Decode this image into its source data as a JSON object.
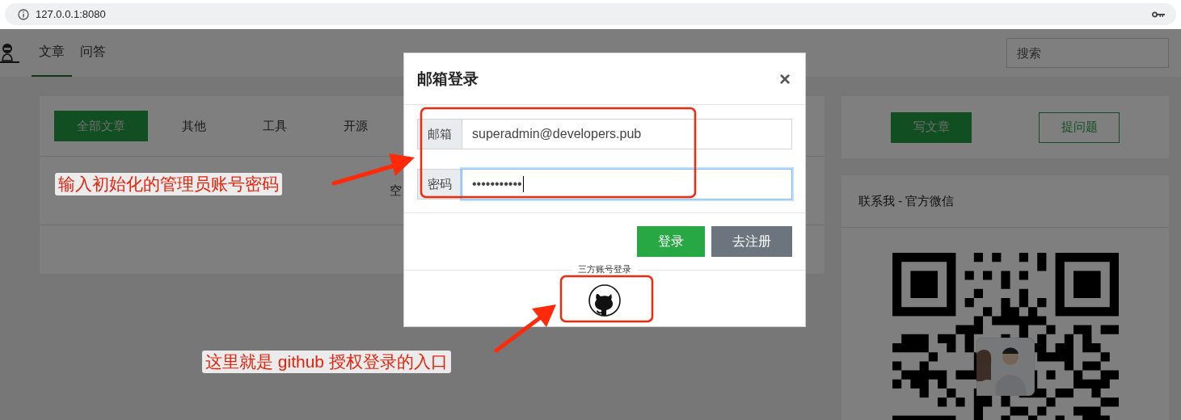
{
  "browser": {
    "address": "127.0.0.1:8080"
  },
  "header": {
    "nav": [
      {
        "label": "文章",
        "selected": true
      },
      {
        "label": "问答",
        "selected": false
      }
    ],
    "search": {
      "placeholder": "搜索"
    }
  },
  "categories": [
    {
      "label": "全部文章",
      "selected": true
    },
    {
      "label": "其他",
      "selected": false
    },
    {
      "label": "工具",
      "selected": false
    },
    {
      "label": "开源",
      "selected": false
    }
  ],
  "article_list": {
    "empty_text": "空"
  },
  "sidebar": {
    "actions": [
      {
        "label": "写文章",
        "kind": "primary"
      },
      {
        "label": "提问题",
        "kind": "outline"
      }
    ],
    "contact": {
      "title": "联系我 - 官方微信"
    }
  },
  "modal": {
    "title": "邮箱登录",
    "close": "×",
    "fields": [
      {
        "label": "邮箱",
        "value": "superadmin@developers.pub",
        "focused": false
      },
      {
        "label": "密码",
        "value": "•••••••••••",
        "focused": true
      }
    ],
    "buttons": [
      {
        "label": "登录",
        "kind": "primary"
      },
      {
        "label": "去注册",
        "kind": "secondary"
      }
    ],
    "third_party": {
      "legend": "三方账号登录"
    }
  },
  "annotations": [
    {
      "text": "输入初始化的管理员账号密码"
    },
    {
      "text": "这里就是 github 授权登录的入口"
    }
  ]
}
